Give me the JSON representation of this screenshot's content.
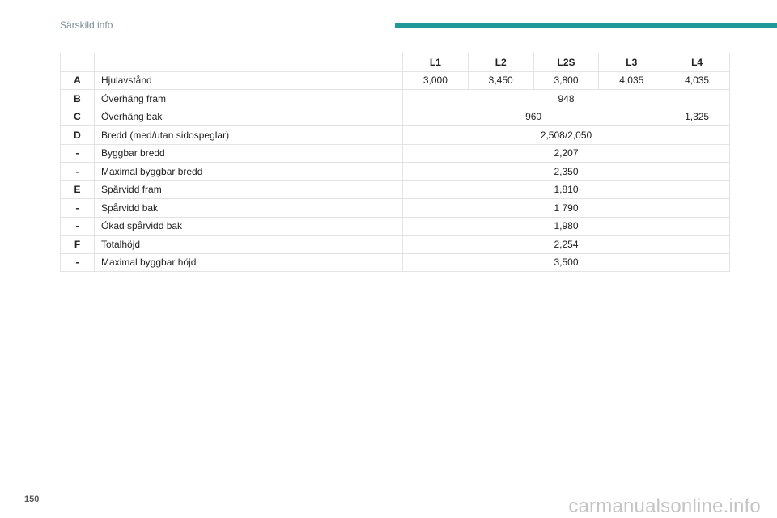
{
  "header": {
    "section_title": "Särskild info",
    "accent_color": "#1f9a98"
  },
  "table": {
    "columns": [
      "L1",
      "L2",
      "L2S",
      "L3",
      "L4"
    ],
    "rows": [
      {
        "letter": "A",
        "label": "Hjulavstånd",
        "cells": [
          "3,000",
          "3,450",
          "3,800",
          "4,035",
          "4,035"
        ]
      },
      {
        "letter": "B",
        "label": "Överhäng fram",
        "cells": [
          "948"
        ]
      },
      {
        "letter": "C",
        "label": "Överhäng bak",
        "cells": [
          "960",
          "1,325"
        ]
      },
      {
        "letter": "D",
        "label": "Bredd (med/utan sidospeglar)",
        "cells": [
          "2,508/2,050"
        ]
      },
      {
        "letter": "-",
        "label": "Byggbar bredd",
        "cells": [
          "2,207"
        ]
      },
      {
        "letter": "-",
        "label": "Maximal byggbar bredd",
        "cells": [
          "2,350"
        ]
      },
      {
        "letter": "E",
        "label": "Spårvidd fram",
        "cells": [
          "1,810"
        ]
      },
      {
        "letter": "-",
        "label": "Spårvidd bak",
        "cells": [
          "1 790"
        ]
      },
      {
        "letter": "-",
        "label": "Ökad spårvidd bak",
        "cells": [
          "1,980"
        ]
      },
      {
        "letter": "F",
        "label": "Totalhöjd",
        "cells": [
          "2,254"
        ]
      },
      {
        "letter": "-",
        "label": "Maximal byggbar höjd",
        "cells": [
          "3,500"
        ]
      }
    ]
  },
  "footer": {
    "page_number": "150",
    "watermark": "carmanualsonline.info"
  }
}
